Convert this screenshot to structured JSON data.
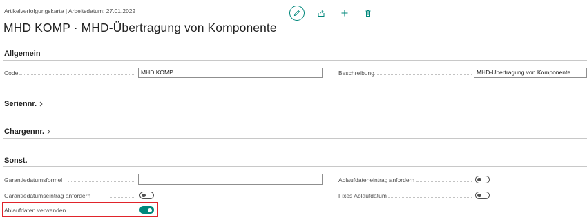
{
  "header": {
    "breadcrumb": "Artikelverfolgungskarte | Arbeitsdatum: 27.01.2022",
    "title": "MHD KOMP · MHD-Übertragung von Komponente"
  },
  "toolbar": {
    "icons": [
      "edit-icon",
      "share-icon",
      "new-icon",
      "delete-icon"
    ]
  },
  "sections": {
    "allgemein": "Allgemein",
    "seriennr": "Seriennr.",
    "chargennr": "Chargennr.",
    "sonst": "Sonst."
  },
  "allgemein": {
    "code_label": "Code",
    "code_value": "MHD KOMP",
    "beschreibung_label": "Beschreibung",
    "beschreibung_value": "MHD-Übertragung von Komponente"
  },
  "sonst": {
    "garantiedatumsformel_label": "Garantiedatumsformel",
    "garantiedatumsformel_value": "",
    "garantiedatumseintrag_label": "Garantiedatumseintrag anfordern",
    "garantiedatumseintrag_on": false,
    "ablaufdaten_verwenden_label": "Ablaufdaten verwenden",
    "ablaufdaten_verwenden_on": true,
    "ablaufdateneintrag_label": "Ablaufdateneintrag anfordern",
    "ablaufdateneintrag_on": false,
    "fixes_ablaufdatum_label": "Fixes Ablaufdatum",
    "fixes_ablaufdatum_on": false
  },
  "colors": {
    "accent": "#00877b",
    "highlight": "#e0242b"
  }
}
